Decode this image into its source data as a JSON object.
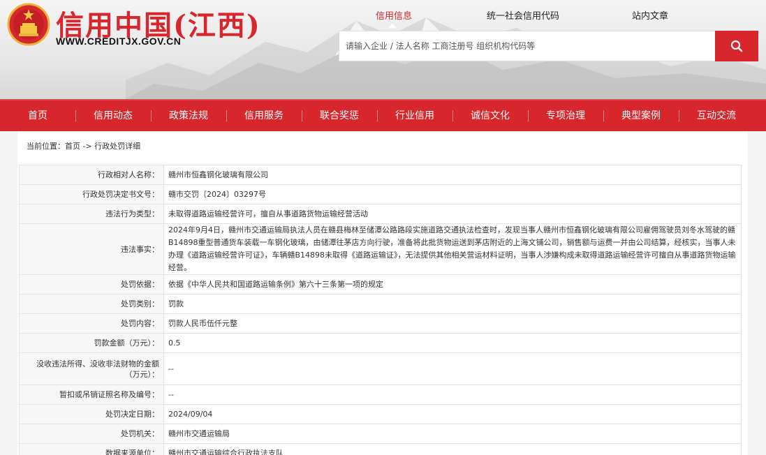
{
  "header": {
    "title": "信用中国(江西)",
    "domain": "WWW.CREDITJX.GOV.CN",
    "search_tabs": [
      "信用信息",
      "统一社会信用代码",
      "站内文章"
    ],
    "search_placeholder": "请输入企业 / 法人名称 工商注册号 组织机构代码等",
    "search_icon": "search-icon",
    "emblem_icon": "national-emblem-icon"
  },
  "nav": {
    "items": [
      "首页",
      "信用动态",
      "政策法规",
      "信用服务",
      "联合奖惩",
      "行业信用",
      "诚信文化",
      "专项治理",
      "典型案例",
      "互动交流"
    ]
  },
  "breadcrumb": "当前位置：首页 -> 行政处罚详细",
  "details": [
    {
      "label": "行政相对人名称：",
      "value": "赣州市恒鑫钢化玻璃有限公司"
    },
    {
      "label": "行政处罚决定书文号：",
      "value": "赣市交罚〔2024〕03297号"
    },
    {
      "label": "违法行为类型：",
      "value": "未取得道路运输经营许可，擅自从事道路货物运输经营活动"
    },
    {
      "label": "违法事实：",
      "value": "2024年9月4日，赣州市交通运输局执法人员在赣县梅林至储潭公路路段实施道路交通执法检查时，发现当事人赣州市恒鑫钢化玻璃有限公司雇佣驾驶员刘冬水驾驶的赣B14898重型普通货车装载一车钢化玻璃，由储潭往茅店方向行驶，准备将此批货物运送到茅店附近的上海文铺公司，销售额与运费一并由公司结算，经核实，当事人未办理《道路运输经营许可证》，车辆赣B14898未取得《道路运输证》，无法提供其他相关营运材料证明，当事人涉嫌构成未取得道路运输经营许可擅自从事道路货物运输经营。"
    },
    {
      "label": "处罚依据：",
      "value": "依据《中华人民共和国道路运输条例》第六十三条第一项的规定"
    },
    {
      "label": "处罚类别：",
      "value": "罚款"
    },
    {
      "label": "处罚内容：",
      "value": "罚款人民币伍仟元整"
    },
    {
      "label": "罚款金额（万元）：",
      "value": "0.5"
    },
    {
      "label": "没收违法所得、没收非法财物的金额（万元）：",
      "value": "--"
    },
    {
      "label": "暂扣或吊销证照名称及编号：",
      "value": "--"
    },
    {
      "label": "处罚决定日期：",
      "value": "2024/09/04"
    },
    {
      "label": "处罚机关：",
      "value": "赣州市交通运输局"
    },
    {
      "label": "数据来源单位：",
      "value": "赣州市交通运输综合行政执法支队"
    }
  ],
  "colors": {
    "brand_red": "#d7262c",
    "label_bg": "#f7f7f7",
    "border": "#e3e3e3"
  }
}
